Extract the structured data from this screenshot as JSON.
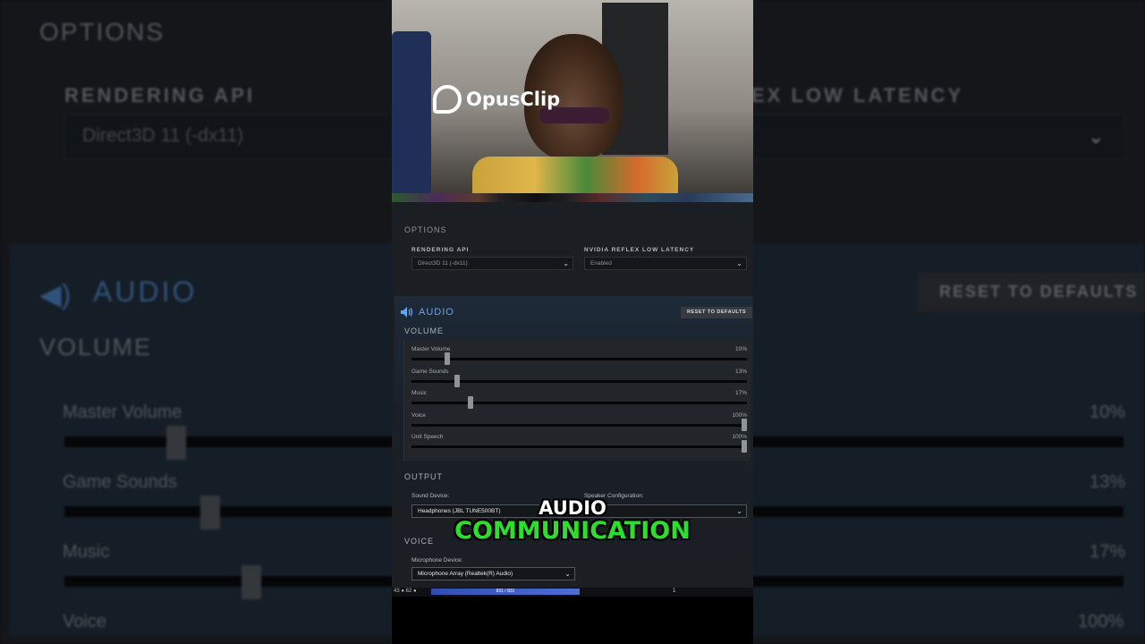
{
  "branding": {
    "logo_text": "OpusClip"
  },
  "options": {
    "section_title": "OPTIONS",
    "rendering_api": {
      "label": "RENDERING API",
      "value": "Direct3D 11 (-dx11)"
    },
    "nvidia_reflex": {
      "label": "NVIDIA REFLEX LOW LATENCY",
      "value": "Enabled"
    }
  },
  "audio": {
    "title": "AUDIO",
    "reset_label": "RESET TO DEFAULTS",
    "volume_title": "VOLUME",
    "sliders": [
      {
        "label": "Master Volume",
        "value_text": "10%",
        "value": 10
      },
      {
        "label": "Game Sounds",
        "value_text": "13%",
        "value": 13
      },
      {
        "label": "Music",
        "value_text": "17%",
        "value": 17
      },
      {
        "label": "Voice",
        "value_text": "100%",
        "value": 100
      },
      {
        "label": "Unit Speech",
        "value_text": "100%",
        "value": 100
      }
    ],
    "output_title": "OUTPUT",
    "sound_device_label": "Sound Device:",
    "sound_device_value": "Headphones (JBL TUNE500BT)",
    "speaker_config_label": "Speaker Configuration:",
    "voice_title": "VOICE",
    "microphone_label": "Microphone Device:",
    "microphone_value": "Microphone Array (Realtek(R) Audio)"
  },
  "background": {
    "options": "OPTIONS",
    "rendering_api": "RENDERING API",
    "rendering_value": "Direct3D 11 (-dx11)",
    "reflex_partial": "EX LOW LATENCY",
    "audio": "AUDIO",
    "reset": "RESET TO DEFAULTS",
    "volume": "VOLUME",
    "master": "Master Volume",
    "game": "Game Sounds",
    "music": "Music",
    "voice": "Voice",
    "v1": "10%",
    "v2": "13%",
    "v3": "17%",
    "v4": "100%"
  },
  "taskbar": {
    "left": "43 ● 62 ●",
    "center": "831 / 831",
    "right": "1"
  },
  "captions": {
    "line1": "AUDIO",
    "line2": "COMMUNICATION"
  },
  "colors": {
    "accent_blue": "#63a4f0",
    "caption_green": "#2be02b"
  }
}
